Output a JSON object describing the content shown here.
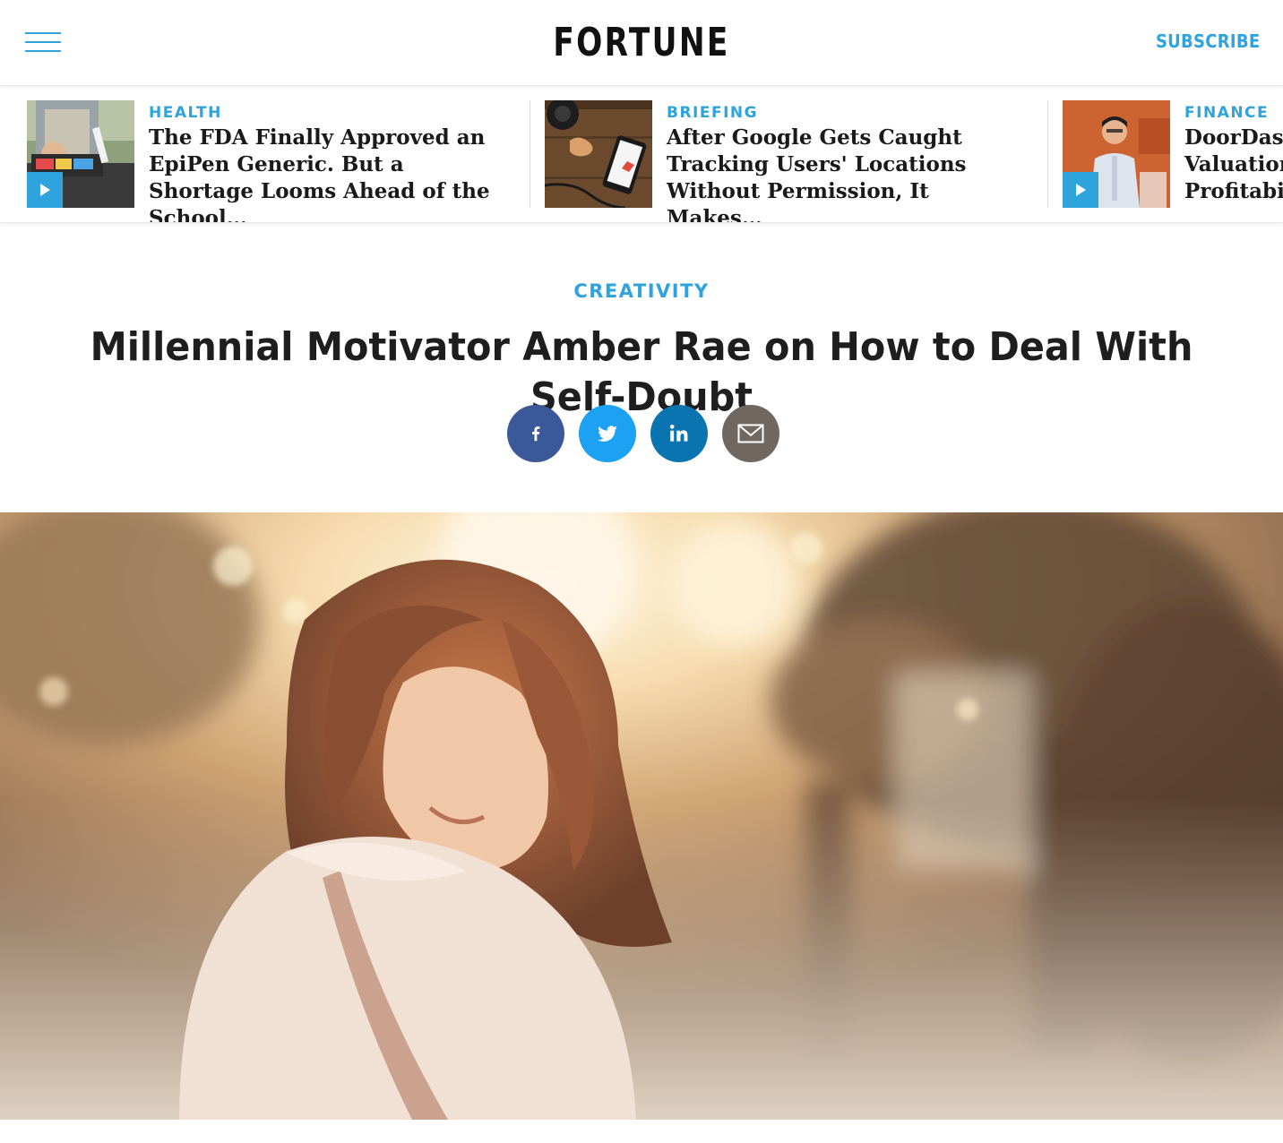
{
  "header": {
    "logo": "FORTUNE",
    "subscribe_label": "SUBSCRIBE",
    "accent_color": "#2ea3dc"
  },
  "trending": [
    {
      "category": "HEALTH",
      "headline": "The FDA Finally Approved an EpiPen Generic. But a Shortage Looms Ahead of the School…",
      "has_video": true
    },
    {
      "category": "BRIEFING",
      "headline": "After Google Gets Caught Tracking Users' Locations Without Permission, It Makes…",
      "has_video": false
    },
    {
      "category": "FINANCE",
      "headline": "DoorDash Valuation Profitabil",
      "has_video": true
    }
  ],
  "article": {
    "section": "CREATIVITY",
    "title": "Millennial Motivator Amber Rae on How to Deal With Self-Doubt"
  },
  "share": {
    "facebook_color": "#3b5998",
    "twitter_color": "#1da1f2",
    "linkedin_color": "#0a74b1",
    "email_color": "#6f6760"
  }
}
